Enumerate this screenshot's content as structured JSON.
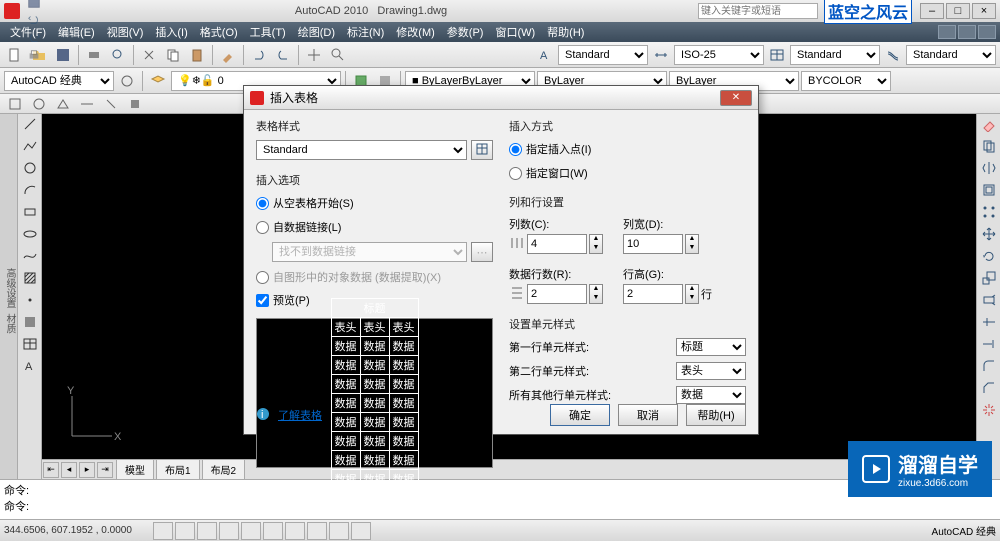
{
  "titlebar": {
    "app": "AutoCAD 2010",
    "doc": "Drawing1.dwg",
    "search_placeholder": "键入关键字或短语",
    "brand": "蓝空之风云"
  },
  "menu": [
    "文件(F)",
    "编辑(E)",
    "视图(V)",
    "插入(I)",
    "格式(O)",
    "工具(T)",
    "绘图(D)",
    "标注(N)",
    "修改(M)",
    "参数(P)",
    "窗口(W)",
    "帮助(H)"
  ],
  "toolbar2": {
    "workspace": "AutoCAD 经典"
  },
  "styles": {
    "text": "Standard",
    "dim": "ISO-25",
    "table": "Standard",
    "ml": "Standard"
  },
  "layers": {
    "color": "ByLayer",
    "ltype": "ByLayer",
    "lweight": "ByLayer",
    "plot": "BYCOLOR"
  },
  "viewtabs": [
    "模型",
    "布局1",
    "布局2"
  ],
  "cmd": {
    "l1": "命令:",
    "l2": "命令:",
    "prompt": "命令:"
  },
  "status": {
    "coords": "344.6506, 607.1952 , 0.0000",
    "right": "AutoCAD 经典"
  },
  "watermark": {
    "text": "溜溜自学",
    "url": "zixue.3d66.com"
  },
  "dialog": {
    "title": "插入表格",
    "table_style_label": "表格样式",
    "table_style": "Standard",
    "insert_options_label": "插入选项",
    "opt_empty": "从空表格开始(S)",
    "opt_link": "自数据链接(L)",
    "link_placeholder": "找不到数据链接",
    "opt_extract": "自图形中的对象数据 (数据提取)(X)",
    "preview_label": "预览(P)",
    "preview_title": "标题",
    "preview_header": "表头",
    "preview_data": "数据",
    "insert_method_label": "插入方式",
    "opt_point": "指定插入点(I)",
    "opt_window": "指定窗口(W)",
    "colrow_label": "列和行设置",
    "cols_label": "列数(C):",
    "cols": "4",
    "colw_label": "列宽(D):",
    "colw": "10",
    "rows_label": "数据行数(R):",
    "rows": "2",
    "rowh_label": "行高(G):",
    "rowh": "2",
    "rowh_unit": "行",
    "cellstyle_label": "设置单元样式",
    "first_row_label": "第一行单元样式:",
    "first_row": "标题",
    "second_row_label": "第二行单元样式:",
    "second_row": "表头",
    "other_row_label": "所有其他行单元样式:",
    "other_row": "数据",
    "learn_link": "了解表格",
    "ok": "确定",
    "cancel": "取消",
    "help": "帮助(H)"
  }
}
